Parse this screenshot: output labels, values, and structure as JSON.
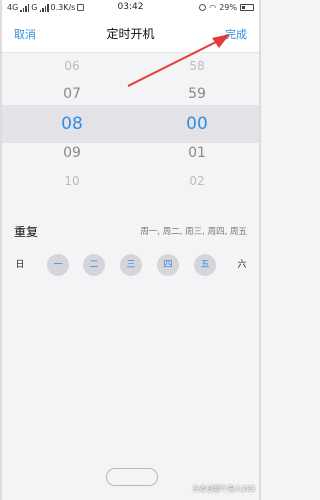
{
  "status_bar": {
    "carrier_left": "4G",
    "carrier_right": "G",
    "speed": "0.3K/s",
    "time": "03:42",
    "battery": "29%"
  },
  "header": {
    "cancel_label": "取消",
    "title": "定时开机",
    "done_label": "完成"
  },
  "picker": {
    "hours": [
      "06",
      "07",
      "08",
      "09",
      "10"
    ],
    "minutes": [
      "58",
      "59",
      "00",
      "01",
      "02"
    ],
    "selected_hour": "08",
    "selected_minute": "00"
  },
  "repeat": {
    "label": "重复",
    "value": "周一, 周二, 周三, 周四, 周五"
  },
  "days": [
    {
      "label": "日",
      "selected": false
    },
    {
      "label": "一",
      "selected": true
    },
    {
      "label": "二",
      "selected": true
    },
    {
      "label": "三",
      "selected": true
    },
    {
      "label": "四",
      "selected": true
    },
    {
      "label": "五",
      "selected": true
    },
    {
      "label": "六",
      "selected": false
    }
  ],
  "watermark": "头条@那个男人283",
  "colors": {
    "accent": "#2f8ee6",
    "arrow": "#e53935",
    "selection_band": "#e3e2e7"
  }
}
